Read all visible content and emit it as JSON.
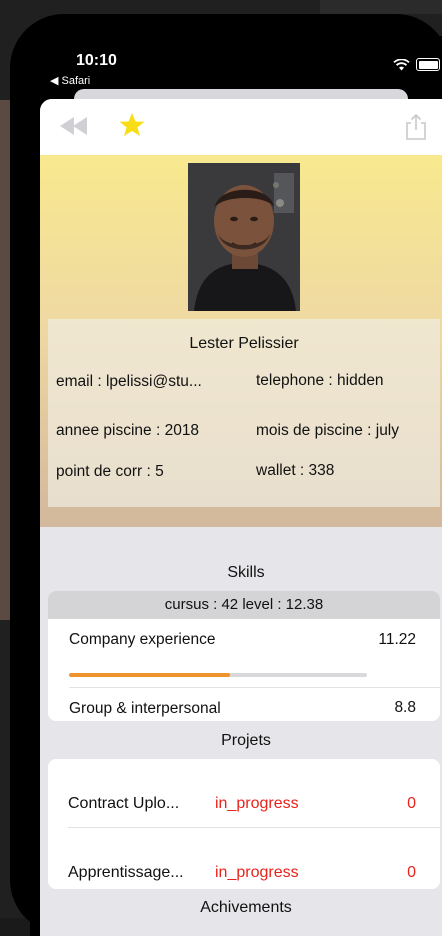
{
  "status_bar": {
    "time": "10:10",
    "back_app": "◀ Safari"
  },
  "toolbar": {
    "rewind_icon": "rewind-icon",
    "star_icon": "star-icon",
    "share_icon": "share-icon",
    "star_color": "#f9dd15"
  },
  "profile": {
    "name": "Lester Pelissier",
    "email": "email : lpelissi@stu...",
    "telephone": "telephone : hidden",
    "annee_piscine": "annee piscine : 2018",
    "mois_piscine": "mois de piscine : july",
    "point_corr": "point de corr : 5",
    "wallet": "wallet : 338"
  },
  "skills": {
    "title": "Skills",
    "cursus": "cursus : 42 level : 12.38",
    "items": [
      {
        "name": "Company experience",
        "level": "11.22",
        "progress": 0.54
      },
      {
        "name": "Group & interpersonal",
        "level": "8.8"
      }
    ],
    "progress_color": "#f0922e"
  },
  "projects": {
    "title": "Projets",
    "items": [
      {
        "name": "Contract Uplo...",
        "status": "in_progress",
        "mark": "0"
      },
      {
        "name": "Apprentissage...",
        "status": "in_progress",
        "mark": "0"
      }
    ],
    "status_color": "#e8231b"
  },
  "achievements": {
    "title": "Achivements"
  }
}
